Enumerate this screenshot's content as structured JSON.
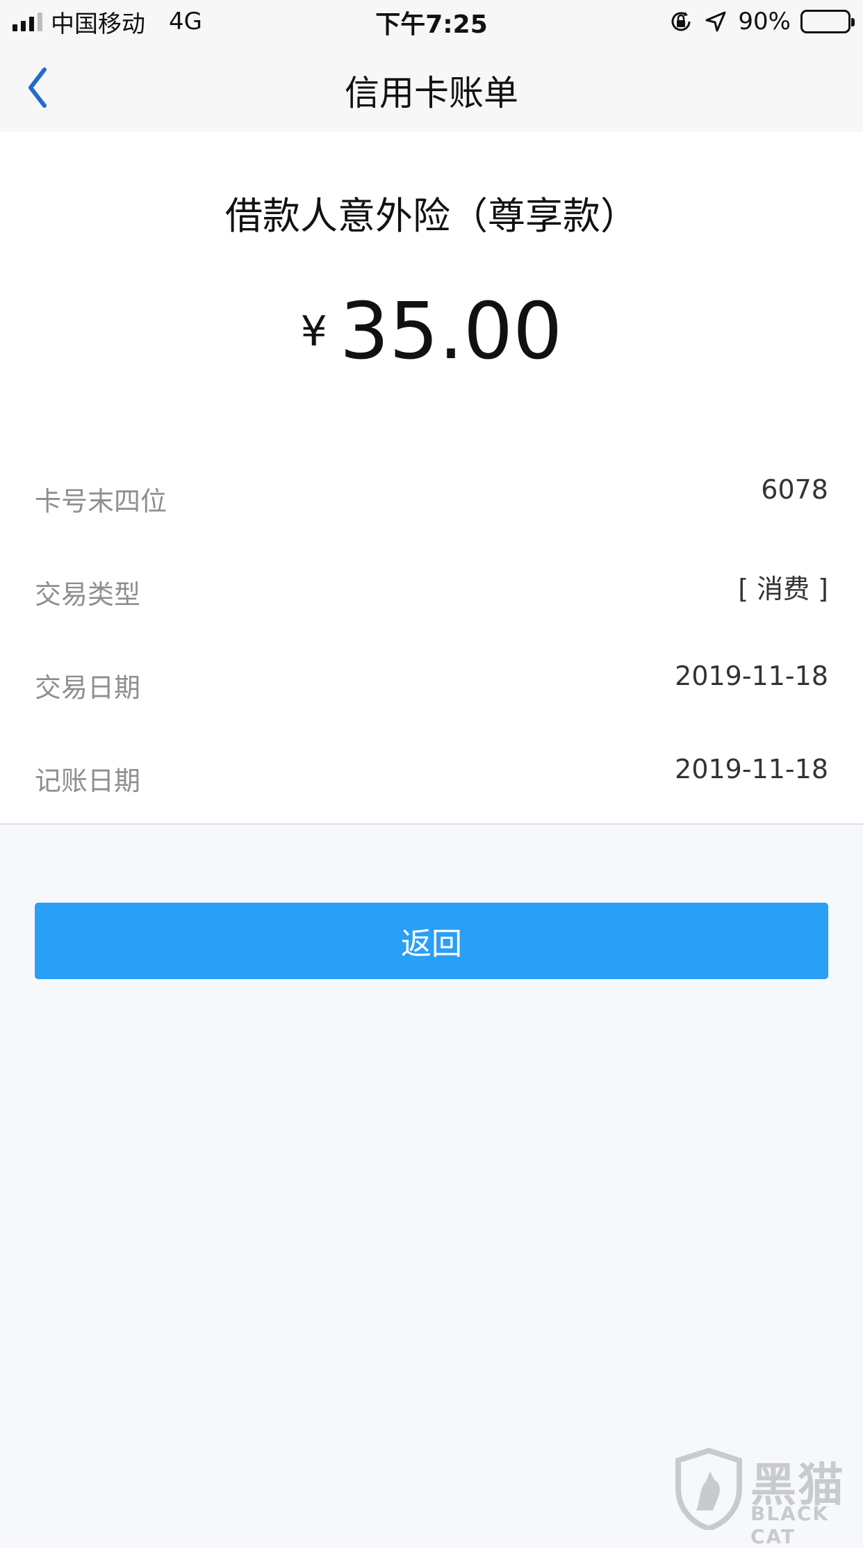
{
  "status_bar": {
    "carrier": "中国移动",
    "network": "4G",
    "time": "下午7:25",
    "battery_percent": "90%",
    "battery_level": 0.9,
    "icons": [
      "signal-icon",
      "orientation-lock-icon",
      "location-arrow-icon",
      "battery-icon"
    ]
  },
  "nav": {
    "title": "信用卡账单",
    "back_icon": "chevron-left-icon"
  },
  "transaction": {
    "merchant": "借款人意外险（尊享款）",
    "currency_symbol": "¥",
    "amount": "35.00"
  },
  "details": [
    {
      "label": "卡号末四位",
      "value": "6078"
    },
    {
      "label": "交易类型",
      "value": "[ 消费 ]"
    },
    {
      "label": "交易日期",
      "value": "2019-11-18"
    },
    {
      "label": "记账日期",
      "value": "2019-11-18"
    }
  ],
  "actions": {
    "return_label": "返回"
  },
  "watermark": {
    "cn": "黑猫",
    "en": "BLACK CAT"
  },
  "colors": {
    "accent_blue": "#2a9ff6",
    "back_icon_blue": "#1f6bd0",
    "page_background": "#f7f8fc"
  }
}
